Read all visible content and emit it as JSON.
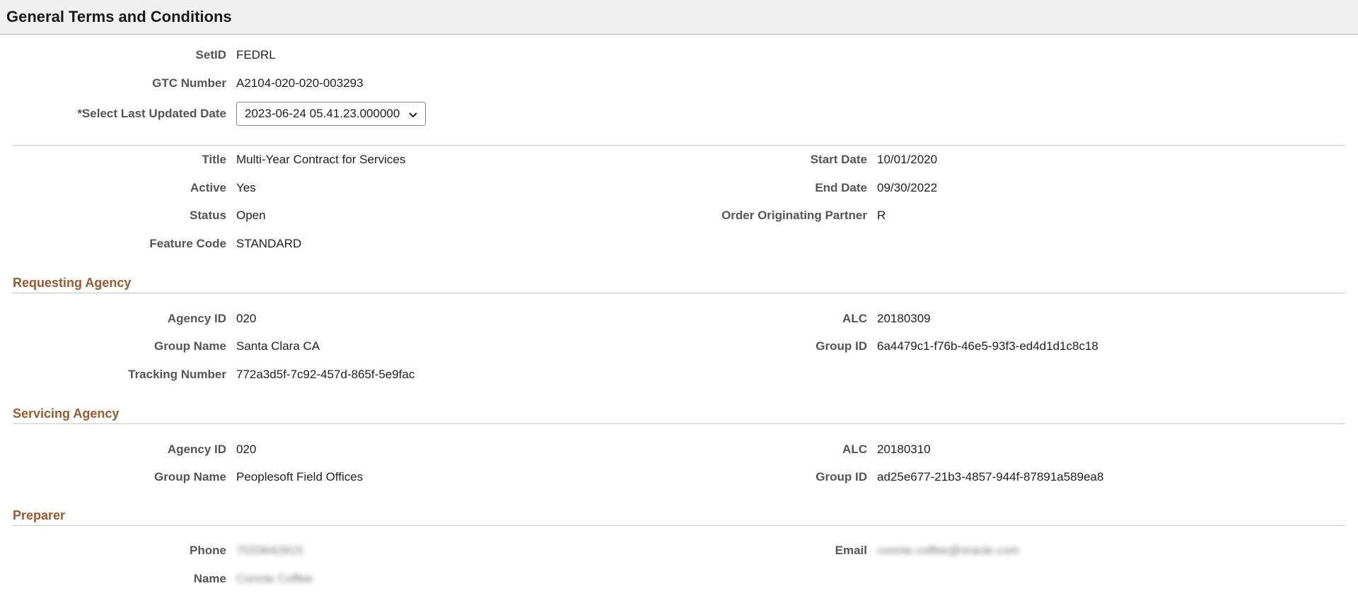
{
  "header": {
    "title": "General Terms and Conditions"
  },
  "gtc": {
    "setid_label": "SetID",
    "setid_value": "FEDRL",
    "gtc_number_label": "GTC Number",
    "gtc_number_value": "A2104-020-020-003293",
    "date_label": "*Select Last Updated Date",
    "date_value": "2023-06-24 05.41.23.000000"
  },
  "details": {
    "title_label": "Title",
    "title_value": "Multi-Year Contract for Services",
    "active_label": "Active",
    "active_value": "Yes",
    "status_label": "Status",
    "status_value": "Open",
    "feature_label": "Feature Code",
    "feature_value": "STANDARD",
    "start_label": "Start Date",
    "start_value": "10/01/2020",
    "end_label": "End Date",
    "end_value": "09/30/2022",
    "partner_label": "Order Originating Partner",
    "partner_value": "R"
  },
  "requesting": {
    "section_title": "Requesting Agency",
    "agency_label": "Agency ID",
    "agency_value": "020",
    "group_name_label": "Group Name",
    "group_name_value": "Santa Clara CA",
    "tracking_label": "Tracking Number",
    "tracking_value": "772a3d5f-7c92-457d-865f-5e9fac",
    "alc_label": "ALC",
    "alc_value": "20180309",
    "group_id_label": "Group ID",
    "group_id_value": "6a4479c1-f76b-46e5-93f3-ed4d1d1c8c18"
  },
  "servicing": {
    "section_title": "Servicing Agency",
    "agency_label": "Agency ID",
    "agency_value": "020",
    "group_name_label": "Group Name",
    "group_name_value": "Peoplesoft Field Offices",
    "alc_label": "ALC",
    "alc_value": "20180310",
    "group_id_label": "Group ID",
    "group_id_value": "ad25e677-21b3-4857-944f-87891a589ea8"
  },
  "preparer": {
    "section_title": "Preparer",
    "phone_label": "Phone",
    "phone_value": "7033642815",
    "name_label": "Name",
    "name_value": "Connie Coffee",
    "email_label": "Email",
    "email_value": "connie.coffee@oracle.com"
  },
  "colors": {
    "section_title": "#9b5a2f",
    "header_bg": "#f0f0f0"
  }
}
